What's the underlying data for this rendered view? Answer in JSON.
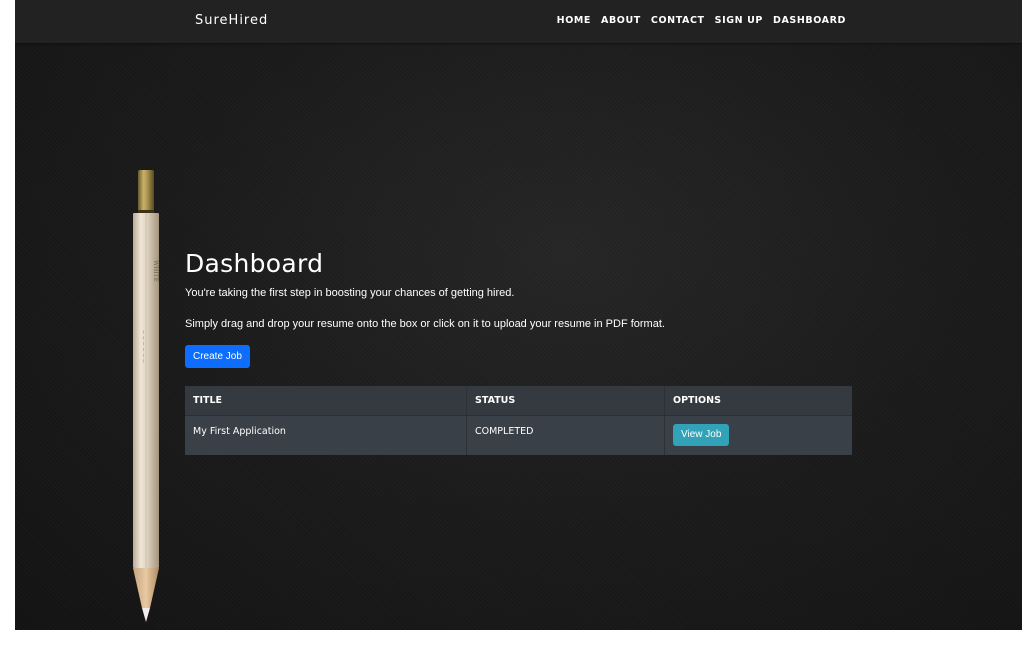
{
  "brand": "SureHired",
  "nav": {
    "items": [
      {
        "label": "HOME"
      },
      {
        "label": "ABOUT"
      },
      {
        "label": "CONTACT"
      },
      {
        "label": "SIGN UP"
      },
      {
        "label": "DASHBOARD"
      }
    ]
  },
  "main": {
    "title": "Dashboard",
    "intro": "You're taking the first step in boosting your chances of getting hired.",
    "instructions": "Simply drag and drop your resume onto the box or click on it to upload your resume in PDF format.",
    "create_button": "Create Job"
  },
  "table": {
    "headers": [
      "TITLE",
      "STATUS",
      "OPTIONS"
    ],
    "rows": [
      {
        "title": "My First Application",
        "status": "COMPLETED",
        "action": "View Job"
      }
    ]
  },
  "colors": {
    "primary": "#0d6efd",
    "info": "#31a2b8",
    "navbar": "#222222",
    "table": "#343a40"
  }
}
